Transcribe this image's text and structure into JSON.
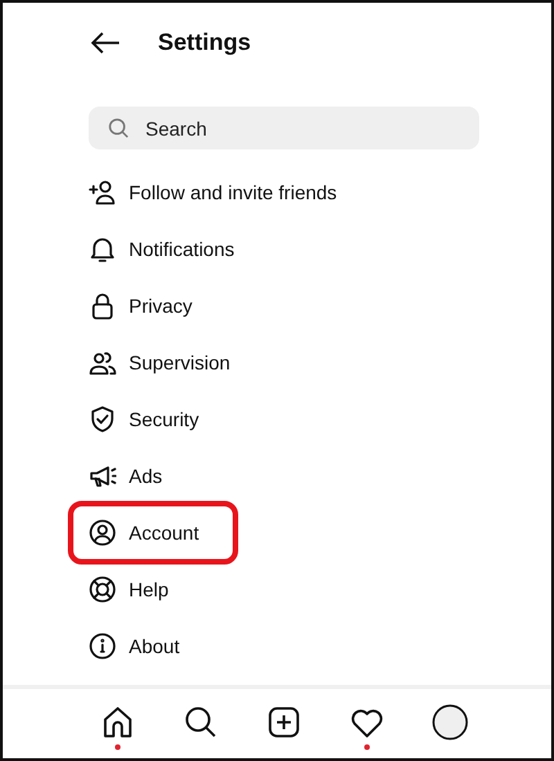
{
  "header": {
    "title": "Settings"
  },
  "search": {
    "placeholder": "Search"
  },
  "items": [
    {
      "label": "Follow and invite friends",
      "highlighted": false
    },
    {
      "label": "Notifications",
      "highlighted": false
    },
    {
      "label": "Privacy",
      "highlighted": false
    },
    {
      "label": "Supervision",
      "highlighted": false
    },
    {
      "label": "Security",
      "highlighted": false
    },
    {
      "label": "Ads",
      "highlighted": false
    },
    {
      "label": "Account",
      "highlighted": true
    },
    {
      "label": "Help",
      "highlighted": false
    },
    {
      "label": "About",
      "highlighted": false
    }
  ],
  "nav": [
    {
      "badge": true
    },
    {
      "badge": false
    },
    {
      "badge": false
    },
    {
      "badge": true
    },
    {
      "badge": false
    }
  ]
}
